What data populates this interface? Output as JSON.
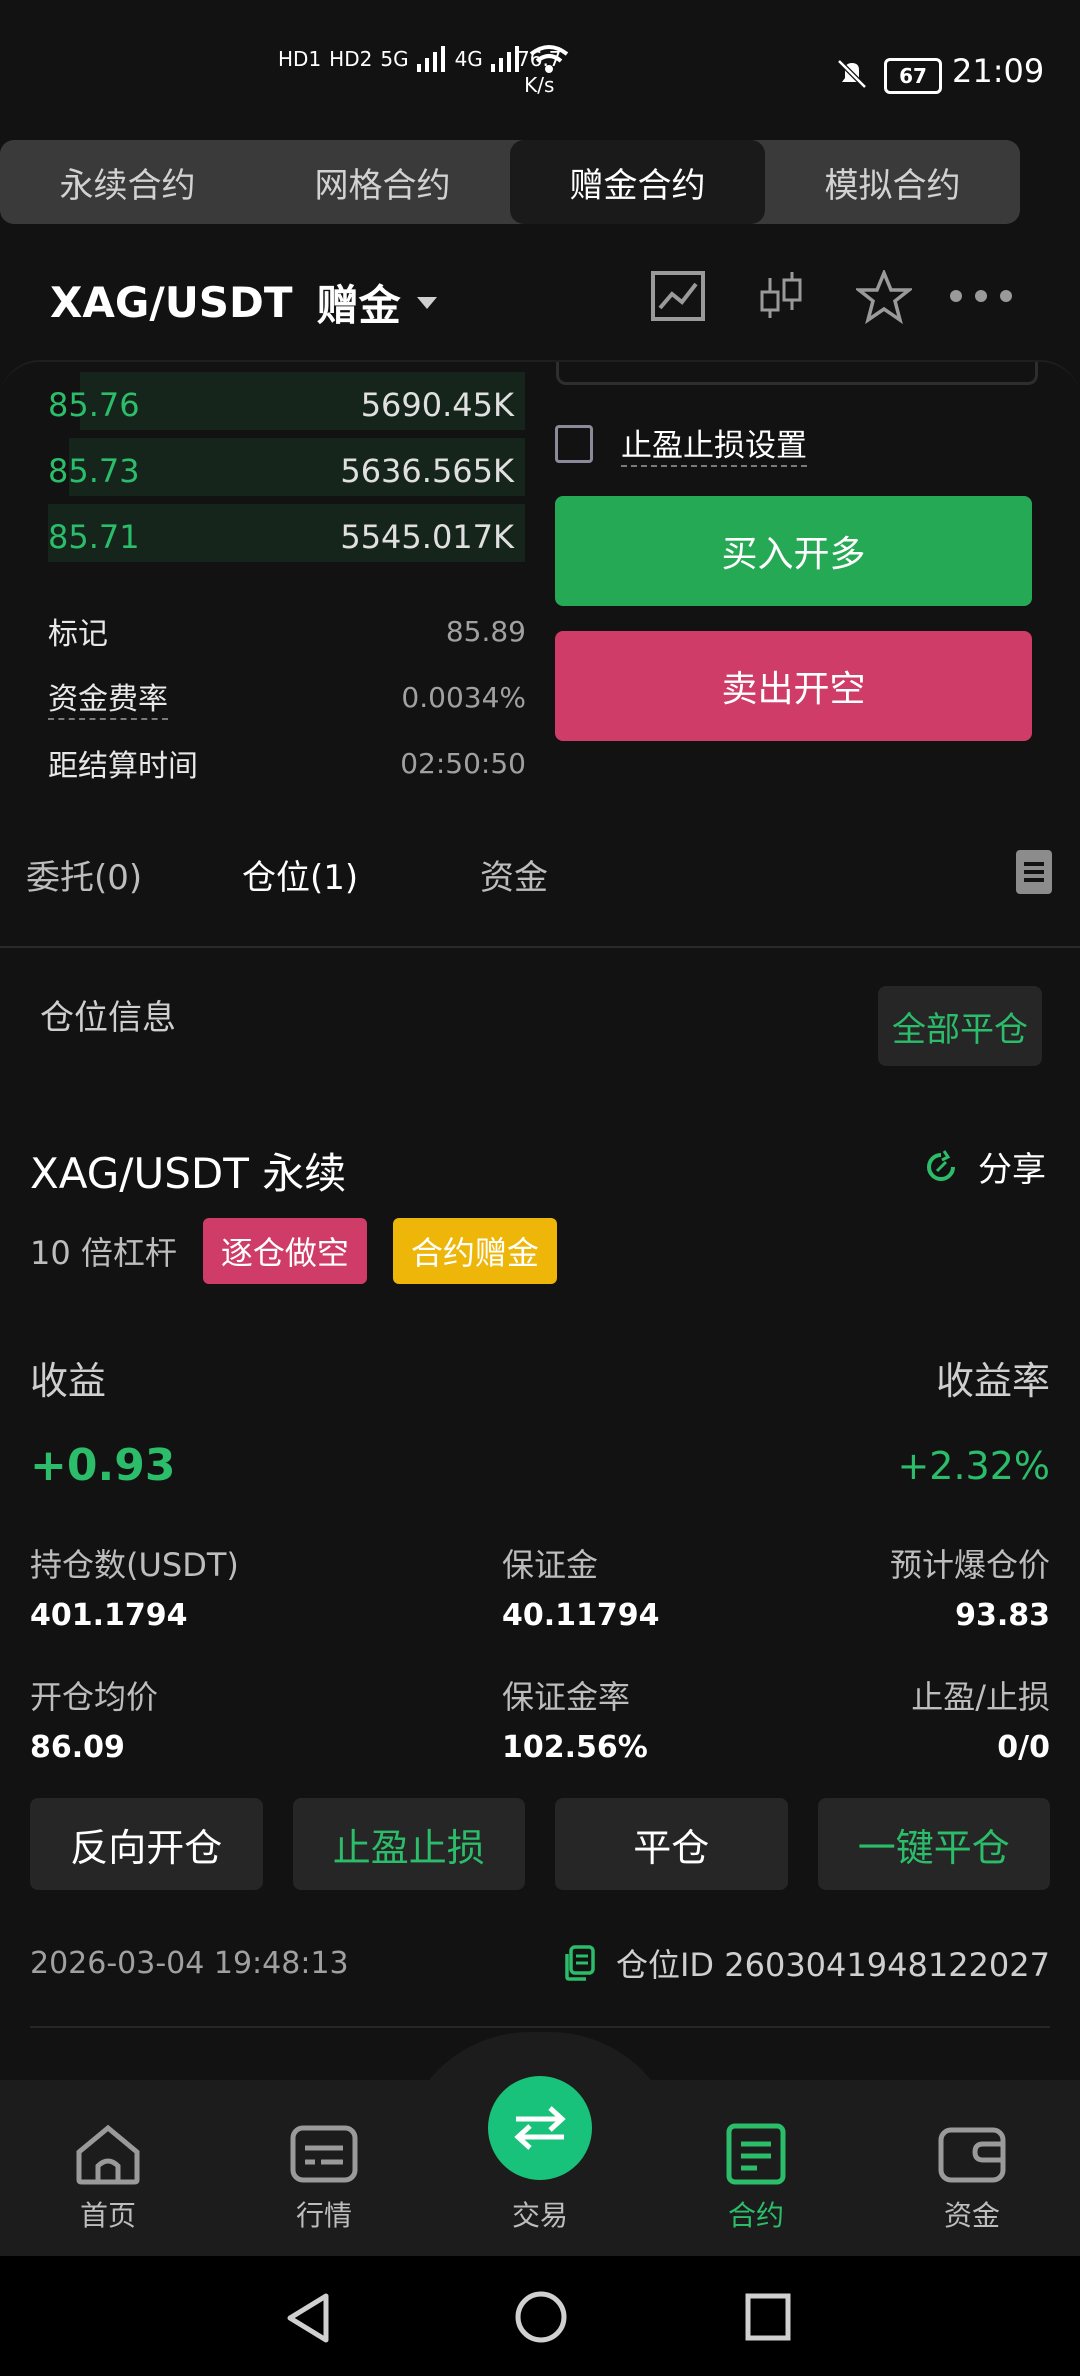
{
  "status_bar": {
    "hd1": "HD1",
    "hd2": "HD2",
    "net1": "5G",
    "net2": "4G",
    "speed_value": "76.7",
    "speed_unit": "K/s",
    "battery": "67",
    "time": "21:09"
  },
  "contract_tabs": [
    "永续合约",
    "网格合约",
    "赠金合约",
    "模拟合约"
  ],
  "symbol": {
    "pair": "XAG/USDT",
    "tag": "赠金"
  },
  "order_book": [
    {
      "price": "85.76",
      "qty": "5690.45K",
      "depth": 0.84
    },
    {
      "price": "85.73",
      "qty": "5636.565K",
      "depth": 0.86
    },
    {
      "price": "85.71",
      "qty": "5545.017K",
      "depth": 0.9
    }
  ],
  "stats": {
    "mark_label": "标记",
    "mark_value": "85.89",
    "funding_label": "资金费率",
    "funding_value": "0.0034%",
    "settle_label": "距结算时间",
    "settle_value": "02:50:50"
  },
  "order_form": {
    "tp_sl_label": "止盈止损设置",
    "buy_label": "买入开多",
    "sell_label": "卖出开空"
  },
  "position_tabs": [
    "委托(0)",
    "仓位(1)",
    "资金"
  ],
  "position_section": {
    "title": "仓位信息",
    "close_all": "全部平仓"
  },
  "position": {
    "symbol": "XAG/USDT 永续",
    "share": "分享",
    "leverage": "10 倍杠杆",
    "badge_side": "逐仓做空",
    "badge_bonus": "合约赠金",
    "pnl_label": "收益",
    "pnl": "+0.93",
    "roe_label": "收益率",
    "roe": "+2.32%",
    "size_label": "持仓数(USDT)",
    "size": "401.1794",
    "margin_label": "保证金",
    "margin": "40.11794",
    "liq_label": "预计爆仓价",
    "liq": "93.83",
    "entry_label": "开仓均价",
    "entry": "86.09",
    "margin_ratio_label": "保证金率",
    "margin_ratio": "102.56%",
    "tpsl_label": "止盈/止损",
    "tpsl": "0/0",
    "actions": [
      "反向开仓",
      "止盈止损",
      "平仓",
      "一键平仓"
    ],
    "open_time": "2026-03-04 19:48:13",
    "id_text": "仓位ID 2603041948122027"
  },
  "bottom_nav": [
    "首页",
    "行情",
    "交易",
    "合约",
    "资金"
  ],
  "colors": {
    "green": "#2bbd6a",
    "red": "#cf3c67",
    "yellow": "#eeb608",
    "fab": "#19c27a"
  }
}
